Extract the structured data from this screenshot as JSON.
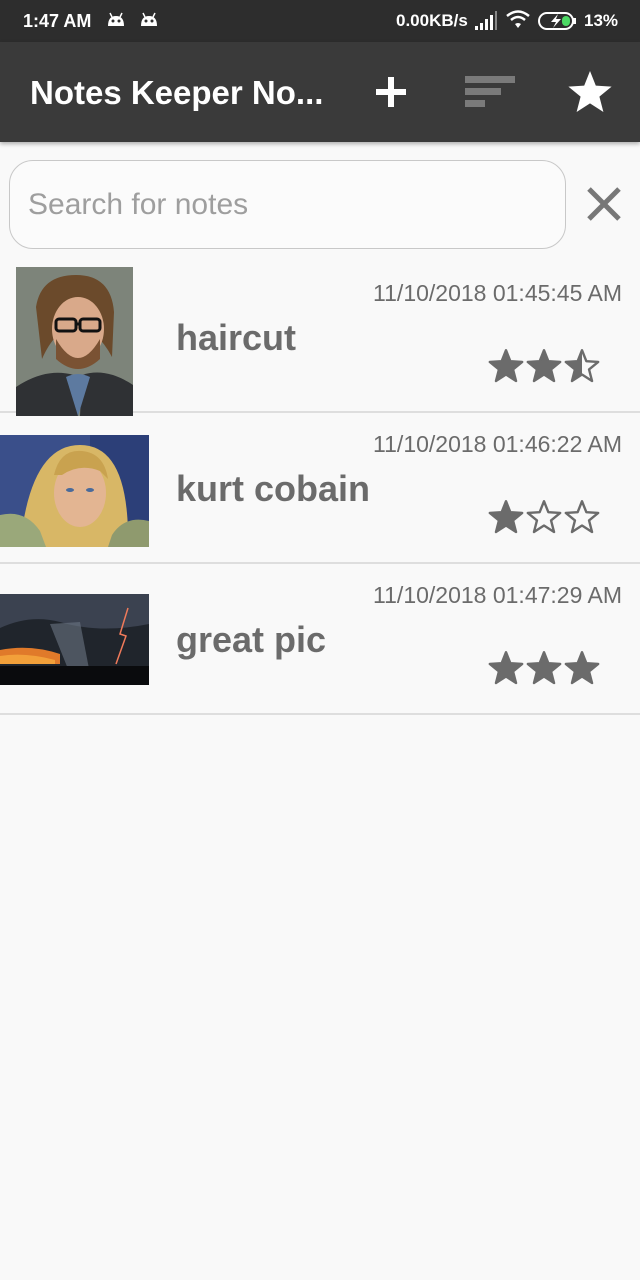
{
  "status_bar": {
    "time": "1:47 AM",
    "speed": "0.00KB/s",
    "battery": "13%"
  },
  "toolbar": {
    "title": "Notes Keeper No...",
    "icons": [
      "add-icon",
      "sort-icon",
      "star-icon"
    ]
  },
  "search": {
    "placeholder": "Search for notes",
    "value": ""
  },
  "notes": [
    {
      "title": "haircut",
      "date": "11/10/2018 01:45:45 AM",
      "rating": 2.5
    },
    {
      "title": "kurt cobain",
      "date": "11/10/2018 01:46:22 AM",
      "rating": 1
    },
    {
      "title": "great pic",
      "date": "11/10/2018 01:47:29 AM",
      "rating": 3
    }
  ],
  "colors": {
    "toolbar": "#3a3a3a",
    "status_bar": "#2d2d2d",
    "text_gray": "#6b6b6b",
    "star": "#6b6b6b"
  }
}
